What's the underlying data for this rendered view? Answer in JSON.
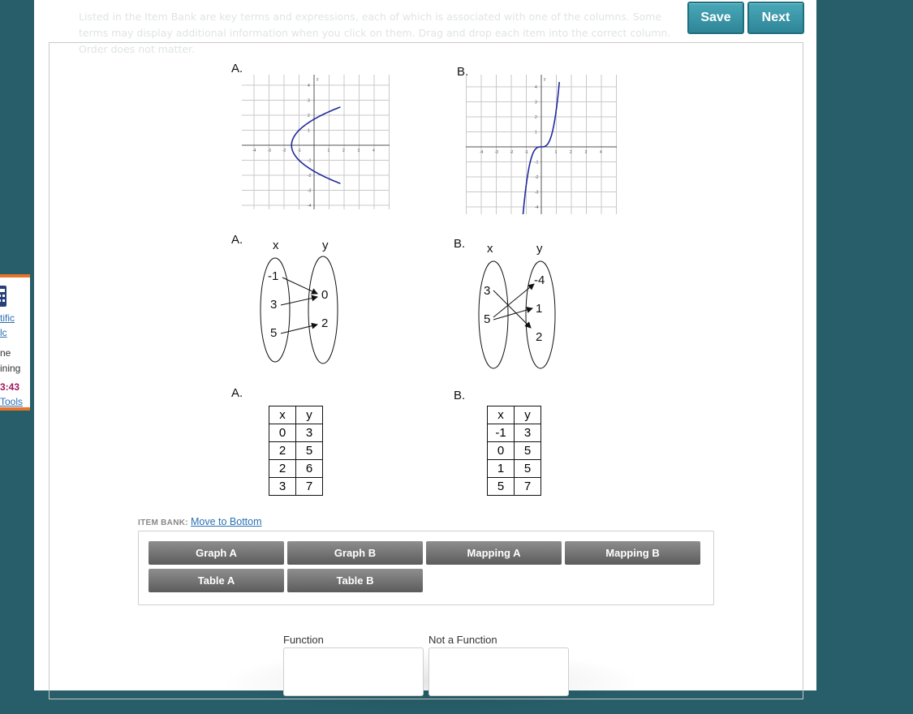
{
  "header": {
    "instructions": "Listed in the Item Bank are key terms and expressions, each of which is associated with one of the columns. Some terms may display additional information when you click on them. Drag and drop each item into the correct column. Order does not matter.",
    "save_label": "Save",
    "next_label": "Next"
  },
  "graphs": {
    "a_label": "A.",
    "b_label": "B.",
    "axis_y": "y",
    "ticks_x": [
      "-4",
      "-3",
      "-2",
      "-1",
      "1",
      "2",
      "3",
      "4"
    ],
    "ticks_y": [
      "4",
      "3",
      "2",
      "1",
      "-1",
      "-2",
      "-3",
      "-4"
    ]
  },
  "mappings": {
    "a_label": "A.",
    "b_label": "B.",
    "a": {
      "x_head": "x",
      "y_head": "y",
      "domain": [
        "-1",
        "3",
        "5"
      ],
      "range": [
        "0",
        "2"
      ]
    },
    "b": {
      "x_head": "x",
      "y_head": "y",
      "domain": [
        "3",
        "5"
      ],
      "range": [
        "-4",
        "1",
        "2"
      ]
    }
  },
  "tables": {
    "a_label": "A.",
    "b_label": "B.",
    "a": {
      "headers": [
        "x",
        "y"
      ],
      "rows": [
        [
          "0",
          "3"
        ],
        [
          "2",
          "5"
        ],
        [
          "2",
          "6"
        ],
        [
          "3",
          "7"
        ]
      ]
    },
    "b": {
      "headers": [
        "x",
        "y"
      ],
      "rows": [
        [
          "-1",
          "3"
        ],
        [
          "0",
          "5"
        ],
        [
          "1",
          "5"
        ],
        [
          "5",
          "7"
        ]
      ]
    }
  },
  "item_bank": {
    "title": "ITEM BANK:",
    "move_link": "Move to Bottom",
    "items": [
      "Graph A",
      "Graph B",
      "Mapping A",
      "Mapping B",
      "Table A",
      "Table B"
    ]
  },
  "columns": {
    "function": "Function",
    "not_function": "Not a Function"
  },
  "side_panel": {
    "calc_line1": "tific",
    "calc_line2": "lc",
    "time_line1": "ne",
    "time_line2": "ining",
    "time_value": "3:43",
    "tools": "Tools"
  },
  "colors": {
    "accent": "#2d8596",
    "background": "#275e69",
    "curve": "#1f2a9c",
    "timer": "#a0185e",
    "panel_border": "#e8742a"
  }
}
